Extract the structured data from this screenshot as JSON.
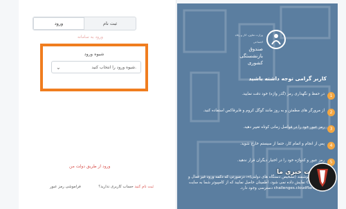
{
  "login": {
    "tabs": [
      "ورود",
      "ثبت نام"
    ],
    "hint_text": "ورود به سامانه",
    "field_label": "شیوه ورود",
    "select_value": "شیوه ورود را انتخاب کنید.",
    "gov_link": "ورود از طریق دولت من",
    "forgot_label": "فراموشی رمز عبور",
    "no_account_label": "حساب کاربری ندارید؟",
    "signup_link": "ثبت نام کنید"
  },
  "panel": {
    "logo_line1": "صندوق بازنشستگی کشوری",
    "logo_line2": "وزارت تعاون، کار و رفاه اجتماعی",
    "title": "کاربر گرامی توجه داشته باشید",
    "tips": [
      {
        "num": "1",
        "text": "در حفظ و نگهداری رمز (گذر واژه) خود دقت نمایید."
      },
      {
        "num": "2",
        "text": "از مرورگر های مطمئن و به روز مانند گوگل کروم و فایرفاکس استفاده کنید."
      },
      {
        "num": "3",
        "text": "رمز عبور خود را در فواصل زمانی کوتاه تغییر دهید."
      },
      {
        "num": "4",
        "text": "پس از انجام و اتمام کار، حتما از سیستم خارج شوید."
      },
      {
        "num": "5",
        "text": "رمز عبور و کدواژه خود را در اختیار دیگران قرار ندهید."
      },
      {
        "num": "6",
        "text": "«سامانه هوشمند (تشخیص دستگاه های دولتی)»: درصورتی که دکمه ورود غیر فعال و CAPTCHA نمایش داده نمی شود، اطمینان حاصل نمایید که از کامپیوتر شما به سایت challenges.cloudflare.com دسترسی وجود دارد."
      }
    ]
  },
  "watermark": {
    "text": "سایت خبری ما",
    "url": "challenges.cloudflare.com"
  },
  "colors": {
    "panel_bg": "#5b7ea0",
    "highlight": "#f07d1f",
    "tip_badge": "#f3a641",
    "link_red": "#d9534f"
  }
}
